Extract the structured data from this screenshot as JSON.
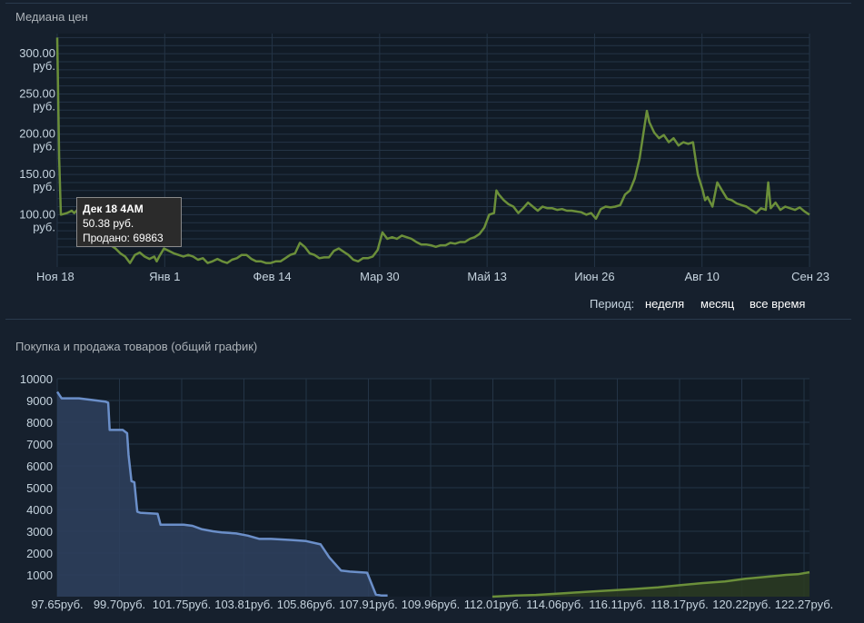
{
  "price_section": {
    "title": "Медиана цен"
  },
  "period": {
    "label": "Период:",
    "options": [
      "неделя",
      "месяц",
      "все время"
    ]
  },
  "tooltip": {
    "date": "Дек 18 4AM",
    "price": "50.38 руб.",
    "sold": "Продано: 69863"
  },
  "orders_section": {
    "title": "Покупка и продажа товаров (общий график)"
  },
  "colors": {
    "price_line": "#6b8f3a",
    "buy_line": "#6b8fc9",
    "sell_line": "#6b8f3a",
    "background": "#16202d",
    "plot_bg": "#111b26"
  },
  "chart_data": [
    {
      "type": "line",
      "x_tick_labels": [
        "Ноя 18",
        "Янв 1",
        "Фев 14",
        "Мар 30",
        "Май 13",
        "Июн 26",
        "Авг 10",
        "Сен 23"
      ],
      "y_ticks": [
        {
          "value": 100,
          "label": [
            "100.00",
            "руб."
          ]
        },
        {
          "value": 150,
          "label": [
            "150.00",
            "руб."
          ]
        },
        {
          "value": 200,
          "label": [
            "200.00",
            "руб."
          ]
        },
        {
          "value": 250,
          "label": [
            "250.00",
            "руб."
          ]
        },
        {
          "value": 300,
          "label": [
            "300.00",
            "руб."
          ]
        }
      ],
      "ylim": [
        45,
        335
      ],
      "x_range_days": [
        0,
        310
      ],
      "series": [
        {
          "points": [
            [
              0,
              330
            ],
            [
              0.8,
              180
            ],
            [
              1.5,
              110
            ],
            [
              4,
              112
            ],
            [
              6,
              115
            ],
            [
              7,
              112
            ],
            [
              9,
              118
            ],
            [
              10,
              128
            ],
            [
              11,
              108
            ],
            [
              12,
              110
            ],
            [
              14,
              100
            ],
            [
              16,
              95
            ],
            [
              18,
              85
            ],
            [
              20,
              80
            ],
            [
              22,
              72
            ],
            [
              24,
              68
            ],
            [
              26,
              62
            ],
            [
              28,
              58
            ],
            [
              30,
              50
            ],
            [
              32,
              60
            ],
            [
              34,
              63
            ],
            [
              36,
              58
            ],
            [
              38,
              55
            ],
            [
              40,
              58
            ],
            [
              41,
              52
            ],
            [
              42,
              58
            ],
            [
              44,
              68
            ],
            [
              46,
              65
            ],
            [
              48,
              62
            ],
            [
              50,
              60
            ],
            [
              52,
              58
            ],
            [
              54,
              60
            ],
            [
              56,
              58
            ],
            [
              58,
              54
            ],
            [
              60,
              56
            ],
            [
              62,
              50
            ],
            [
              64,
              52
            ],
            [
              66,
              55
            ],
            [
              68,
              52
            ],
            [
              70,
              50
            ],
            [
              72,
              54
            ],
            [
              74,
              56
            ],
            [
              76,
              60
            ],
            [
              78,
              60
            ],
            [
              80,
              55
            ],
            [
              82,
              52
            ],
            [
              84,
              52
            ],
            [
              86,
              50
            ],
            [
              88,
              50
            ],
            [
              90,
              52
            ],
            [
              92,
              52
            ],
            [
              94,
              56
            ],
            [
              96,
              60
            ],
            [
              98,
              62
            ],
            [
              100,
              75
            ],
            [
              102,
              70
            ],
            [
              104,
              62
            ],
            [
              106,
              60
            ],
            [
              108,
              56
            ],
            [
              110,
              57
            ],
            [
              112,
              57
            ],
            [
              114,
              65
            ],
            [
              116,
              68
            ],
            [
              118,
              64
            ],
            [
              120,
              60
            ],
            [
              122,
              54
            ],
            [
              124,
              52
            ],
            [
              126,
              56
            ],
            [
              128,
              56
            ],
            [
              130,
              58
            ],
            [
              132,
              66
            ],
            [
              134,
              88
            ],
            [
              136,
              80
            ],
            [
              138,
              82
            ],
            [
              140,
              80
            ],
            [
              142,
              84
            ],
            [
              144,
              82
            ],
            [
              146,
              80
            ],
            [
              148,
              76
            ],
            [
              150,
              73
            ],
            [
              152,
              73
            ],
            [
              154,
              72
            ],
            [
              156,
              70
            ],
            [
              158,
              72
            ],
            [
              160,
              72
            ],
            [
              162,
              75
            ],
            [
              164,
              74
            ],
            [
              166,
              76
            ],
            [
              168,
              76
            ],
            [
              170,
              80
            ],
            [
              172,
              82
            ],
            [
              174,
              86
            ],
            [
              176,
              94
            ],
            [
              178,
              110
            ],
            [
              180,
              112
            ],
            [
              181,
              140
            ],
            [
              182,
              135
            ],
            [
              184,
              128
            ],
            [
              186,
              123
            ],
            [
              188,
              120
            ],
            [
              190,
              112
            ],
            [
              192,
              118
            ],
            [
              194,
              125
            ],
            [
              196,
              120
            ],
            [
              198,
              115
            ],
            [
              200,
              120
            ],
            [
              202,
              118
            ],
            [
              204,
              118
            ],
            [
              206,
              116
            ],
            [
              208,
              117
            ],
            [
              210,
              115
            ],
            [
              212,
              115
            ],
            [
              214,
              114
            ],
            [
              216,
              113
            ],
            [
              218,
              110
            ],
            [
              220,
              112
            ],
            [
              222,
              105
            ],
            [
              224,
              117
            ],
            [
              226,
              120
            ],
            [
              228,
              119
            ],
            [
              230,
              120
            ],
            [
              232,
              122
            ],
            [
              234,
              135
            ],
            [
              236,
              140
            ],
            [
              238,
              155
            ],
            [
              240,
              180
            ],
            [
              242,
              220
            ],
            [
              243,
              239
            ],
            [
              244,
              225
            ],
            [
              246,
              212
            ],
            [
              248,
              205
            ],
            [
              250,
              209
            ],
            [
              252,
              200
            ],
            [
              254,
              205
            ],
            [
              256,
              196
            ],
            [
              258,
              200
            ],
            [
              260,
              198
            ],
            [
              262,
              200
            ],
            [
              264,
              160
            ],
            [
              265,
              150
            ],
            [
              266,
              140
            ],
            [
              267,
              128
            ],
            [
              268,
              132
            ],
            [
              270,
              120
            ],
            [
              272,
              150
            ],
            [
              274,
              140
            ],
            [
              276,
              130
            ],
            [
              278,
              128
            ],
            [
              280,
              124
            ],
            [
              282,
              122
            ],
            [
              284,
              120
            ],
            [
              286,
              116
            ],
            [
              288,
              112
            ],
            [
              290,
              118
            ],
            [
              292,
              116
            ],
            [
              293,
              150
            ],
            [
              294,
              118
            ],
            [
              296,
              125
            ],
            [
              298,
              116
            ],
            [
              300,
              120
            ],
            [
              302,
              118
            ],
            [
              304,
              116
            ],
            [
              306,
              119
            ],
            [
              308,
              114
            ],
            [
              310,
              110
            ]
          ]
        }
      ]
    },
    {
      "type": "area",
      "x_tick_labels": [
        "97.65руб.",
        "99.70руб.",
        "101.75руб.",
        "103.81руб.",
        "105.86руб.",
        "107.91руб.",
        "109.96руб.",
        "112.01руб.",
        "114.06руб.",
        "116.11руб.",
        "118.17руб.",
        "120.22руб.",
        "122.27руб."
      ],
      "y_tick_labels": [
        "1000",
        "2000",
        "3000",
        "4000",
        "5000",
        "6000",
        "7000",
        "8000",
        "9000",
        "10000"
      ],
      "xlim": [
        97.65,
        123.5
      ],
      "ylim": [
        0,
        10000
      ],
      "series": [
        {
          "name": "buy",
          "points": [
            [
              97.65,
              9400
            ],
            [
              97.8,
              9100
            ],
            [
              98.4,
              9100
            ],
            [
              99.0,
              9000
            ],
            [
              99.3,
              8950
            ],
            [
              99.4,
              8900
            ],
            [
              99.45,
              7650
            ],
            [
              99.9,
              7650
            ],
            [
              100.05,
              7500
            ],
            [
              100.1,
              6500
            ],
            [
              100.2,
              5300
            ],
            [
              100.3,
              5250
            ],
            [
              100.4,
              3900
            ],
            [
              100.5,
              3850
            ],
            [
              101.1,
              3800
            ],
            [
              101.2,
              3300
            ],
            [
              102.0,
              3300
            ],
            [
              102.3,
              3250
            ],
            [
              102.6,
              3100
            ],
            [
              103.0,
              3000
            ],
            [
              103.3,
              2950
            ],
            [
              103.8,
              2900
            ],
            [
              104.2,
              2800
            ],
            [
              104.6,
              2650
            ],
            [
              105.0,
              2650
            ],
            [
              105.7,
              2600
            ],
            [
              106.2,
              2550
            ],
            [
              106.7,
              2400
            ],
            [
              107.0,
              1800
            ],
            [
              107.4,
              1200
            ],
            [
              107.7,
              1150
            ],
            [
              108.3,
              1100
            ],
            [
              108.6,
              100
            ],
            [
              108.8,
              50
            ],
            [
              109.0,
              50
            ]
          ]
        },
        {
          "name": "sell",
          "points": [
            [
              112.6,
              0
            ],
            [
              113.4,
              50
            ],
            [
              114.1,
              80
            ],
            [
              115.0,
              150
            ],
            [
              115.8,
              220
            ],
            [
              116.6,
              280
            ],
            [
              117.4,
              340
            ],
            [
              118.3,
              430
            ],
            [
              119.0,
              520
            ],
            [
              119.8,
              620
            ],
            [
              120.6,
              700
            ],
            [
              121.3,
              820
            ],
            [
              122.1,
              920
            ],
            [
              122.7,
              1000
            ],
            [
              123.1,
              1030
            ],
            [
              123.5,
              1120
            ]
          ]
        }
      ]
    }
  ]
}
